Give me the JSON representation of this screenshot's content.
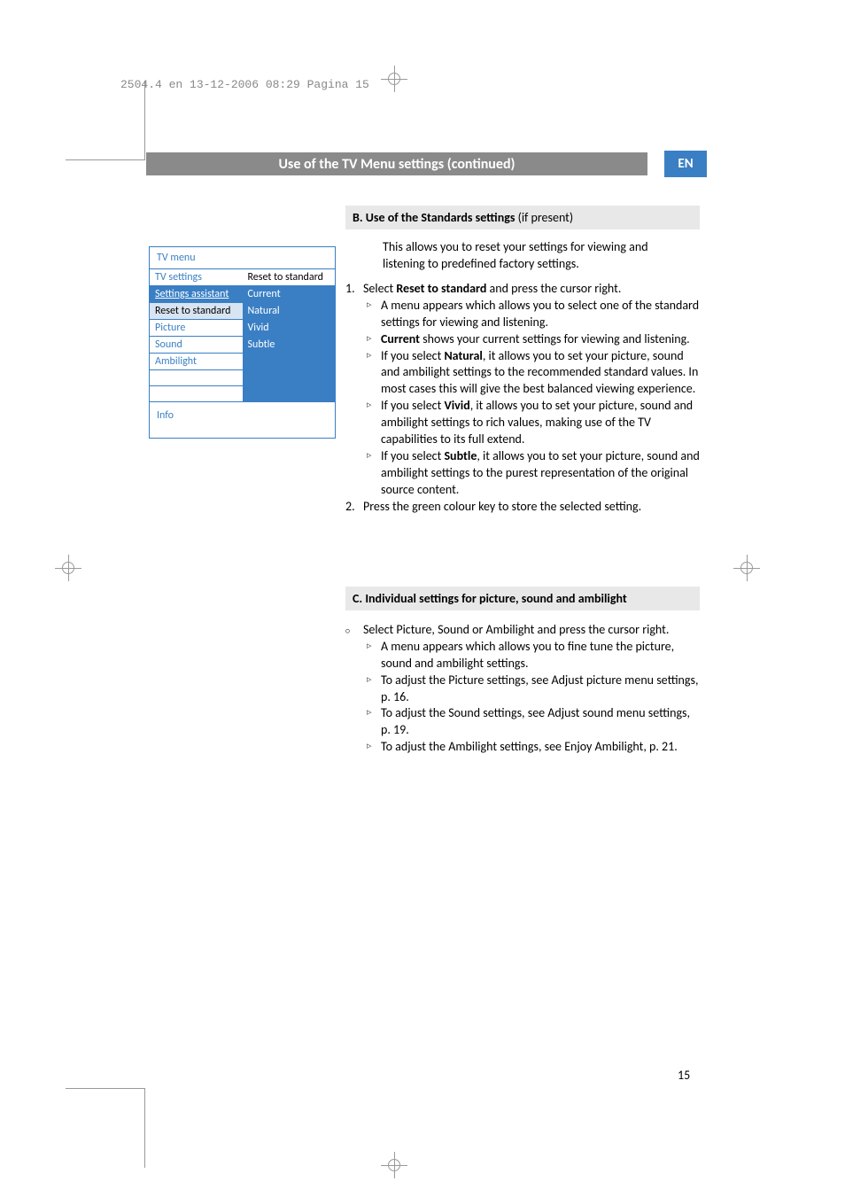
{
  "slug": "2504.4 en  13-12-2006  08:29  Pagina 15",
  "title": "Use of the TV Menu settings  (continued)",
  "lang_tab": "EN",
  "menu": {
    "title": "TV menu",
    "col1_header": "TV settings",
    "col2_header": "Reset to standard",
    "left_items": [
      "Settings assistant",
      "Reset to standard",
      "Picture",
      "Sound",
      "Ambilight"
    ],
    "right_items": [
      "Current",
      "Natural",
      "Vivid",
      "Subtle"
    ],
    "info": "Info"
  },
  "section_b": {
    "heading_bold": "B. Use of the Standards settings",
    "heading_paren": " (if present)",
    "intro": "This allows you to reset your settings for viewing and listening to predefined factory settings.",
    "step1_prefix": "Select ",
    "step1_bold": "Reset to standard",
    "step1_suffix": " and press the cursor right.",
    "sub1": "A menu appears which allows you to select one of the standard settings for viewing and listening.",
    "sub2_bold": "Current",
    "sub2_rest": " shows your current settings for viewing and listening.",
    "sub3_pre": "If you select ",
    "sub3_bold": "Natural",
    "sub3_rest": ", it allows you to set your picture, sound and ambilight settings to the recommended standard values. In most cases this will give the best balanced viewing experience.",
    "sub4_pre": "If you select ",
    "sub4_bold": "Vivid",
    "sub4_rest": ", it allows you to set your picture, sound and ambilight settings to rich values, making use of the TV capabilities to its full extend.",
    "sub5_pre": "If you select ",
    "sub5_bold": "Subtle",
    "sub5_rest": ", it allows you to set your picture, sound and ambilight settings to the purest representation of the original source content.",
    "step2": "Press the green colour key to store the selected setting."
  },
  "section_c": {
    "heading": "C. Individual settings for picture, sound and ambilight",
    "main": "Select Picture, Sound or Ambilight and press the cursor right.",
    "sub1": "A menu appears which allows you to fine tune the picture, sound and ambilight settings.",
    "sub2": "To adjust the Picture settings, see Adjust picture menu settings, p. 16.",
    "sub3": "To adjust the Sound settings, see Adjust sound menu settings, p. 19.",
    "sub4": "To adjust the Ambilight settings, see Enjoy Ambilight, p. 21."
  },
  "page_number": "15"
}
